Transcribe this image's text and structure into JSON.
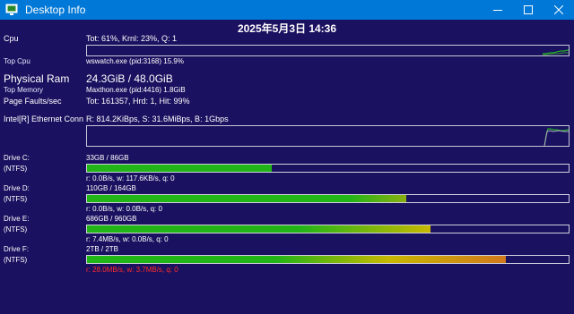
{
  "window": {
    "title": "Desktop Info",
    "icon": "desktop-info-app-icon"
  },
  "datetime": "2025年5月3日 14:36",
  "cpu": {
    "label": "Cpu",
    "value": "Tot: 61%, Krnl: 23%, Q: 1"
  },
  "top_cpu": {
    "label": "Top Cpu",
    "value": "wswatch.exe (pid:3168) 15.9%"
  },
  "ram": {
    "label": "Physical Ram",
    "value": "24.3GiB / 48.0GiB"
  },
  "top_memory": {
    "label": "Top Memory",
    "value": "Maxthon.exe (pid:4416) 1.8GiB"
  },
  "page_faults": {
    "label": "Page Faults/sec",
    "value": "Tot: 161357, Hrd: 1, Hit: 99%"
  },
  "network": {
    "label": "Intel[R] Ethernet Conn",
    "value": "R: 814.2KiBps, S: 31.6MiBps, B: 1Gbps"
  },
  "drives": [
    {
      "label": "Drive C:",
      "fs": "(NTFS)",
      "size": "33GB / 86GB",
      "used_fraction": 0.383,
      "io": "r: 0.0B/s, w: 117.6KB/s, q: 0",
      "io_warn": false
    },
    {
      "label": "Drive D:",
      "fs": "(NTFS)",
      "size": "110GB / 164GB",
      "used_fraction": 0.663,
      "io": "r: 0.0B/s, w: 0.0B/s, q: 0",
      "io_warn": false
    },
    {
      "label": "Drive E:",
      "fs": "(NTFS)",
      "size": "686GB / 960GB",
      "used_fraction": 0.714,
      "io": "r: 7.4MB/s, w: 0.0B/s, q: 0",
      "io_warn": false
    },
    {
      "label": "Drive F:",
      "fs": "(NTFS)",
      "size": "2TB / 2TB",
      "used_fraction": 0.87,
      "io": "r: 28.0MB/s, w: 3.7MB/s, q: 0",
      "io_warn": true
    }
  ],
  "colors": {
    "background": "#1a1260",
    "titlebar": "#0078d7",
    "bar_green": "#22b518",
    "bar_yellow": "#c8b800",
    "bar_orange": "#d2781c",
    "graph_line": "#22c81a",
    "warn": "#ff2a2a"
  }
}
